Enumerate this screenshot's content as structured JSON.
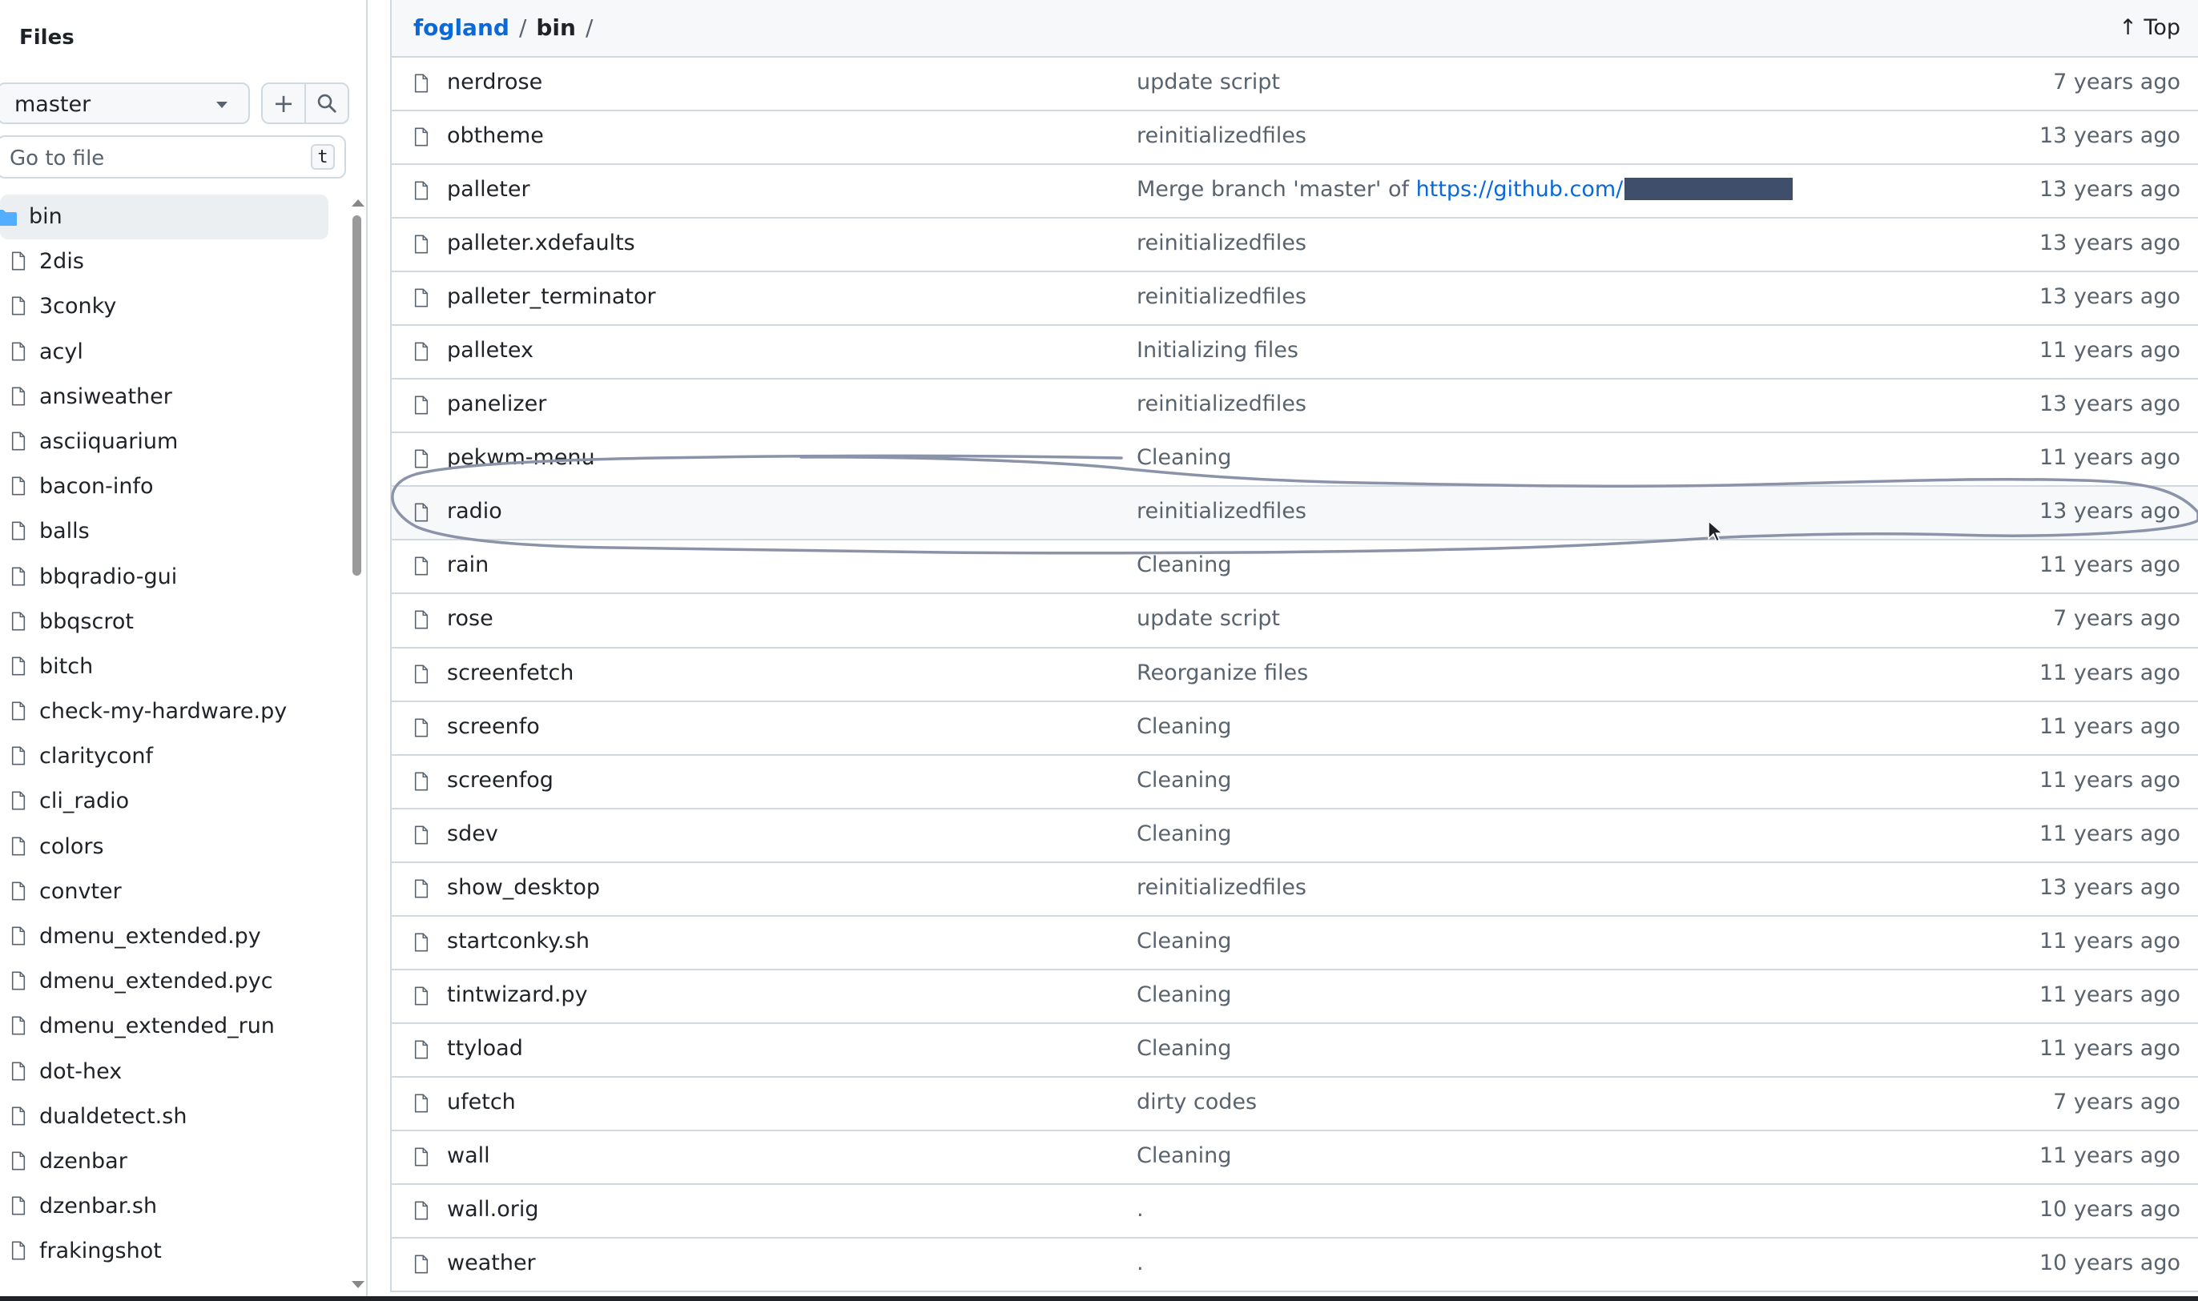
{
  "sidebar": {
    "title": "Files",
    "branch": "master",
    "add_icon": "plus-icon",
    "search_icon": "search-icon",
    "goto_placeholder": "Go to file",
    "goto_shortcut": "t",
    "tree": [
      {
        "label": "bin",
        "type": "folder",
        "selected": true
      },
      {
        "label": "2dis",
        "type": "file"
      },
      {
        "label": "3conky",
        "type": "file"
      },
      {
        "label": "acyl",
        "type": "file"
      },
      {
        "label": "ansiweather",
        "type": "file"
      },
      {
        "label": "asciiquarium",
        "type": "file"
      },
      {
        "label": "bacon-info",
        "type": "file"
      },
      {
        "label": "balls",
        "type": "file"
      },
      {
        "label": "bbqradio-gui",
        "type": "file"
      },
      {
        "label": "bbqscrot",
        "type": "file"
      },
      {
        "label": "bitch",
        "type": "file"
      },
      {
        "label": "check-my-hardware.py",
        "type": "file"
      },
      {
        "label": "clarityconf",
        "type": "file"
      },
      {
        "label": "cli_radio",
        "type": "file"
      },
      {
        "label": "colors",
        "type": "file"
      },
      {
        "label": "convter",
        "type": "file"
      },
      {
        "label": "dmenu_extended.py",
        "type": "file"
      },
      {
        "label": "dmenu_extended.pyc",
        "type": "file"
      },
      {
        "label": "dmenu_extended_run",
        "type": "file"
      },
      {
        "label": "dot-hex",
        "type": "file"
      },
      {
        "label": "dualdetect.sh",
        "type": "file"
      },
      {
        "label": "dzenbar",
        "type": "file"
      },
      {
        "label": "dzenbar.sh",
        "type": "file"
      },
      {
        "label": "frakingshot",
        "type": "file"
      }
    ]
  },
  "breadcrumb": {
    "repo": "fogland",
    "sep": "/",
    "dir": "bin",
    "trailing": "/"
  },
  "top_button": "↑ Top",
  "files": [
    {
      "name": "nerdrose",
      "message": "update script",
      "date": "7 years ago"
    },
    {
      "name": "obtheme",
      "message": "reinitializedfiles",
      "date": "13 years ago"
    },
    {
      "name": "palleter",
      "message": "Merge branch 'master' of ",
      "link": "https://github.com/",
      "redacted": true,
      "date": "13 years ago"
    },
    {
      "name": "palleter.xdefaults",
      "message": "reinitializedfiles",
      "date": "13 years ago"
    },
    {
      "name": "palleter_terminator",
      "message": "reinitializedfiles",
      "date": "13 years ago"
    },
    {
      "name": "palletex",
      "message": "Initializing files",
      "date": "11 years ago"
    },
    {
      "name": "panelizer",
      "message": "reinitializedfiles",
      "date": "13 years ago"
    },
    {
      "name": "pekwm-menu",
      "message": "Cleaning",
      "date": "11 years ago"
    },
    {
      "name": "radio",
      "message": "reinitializedfiles",
      "date": "13 years ago",
      "hover": true
    },
    {
      "name": "rain",
      "message": "Cleaning",
      "date": "11 years ago"
    },
    {
      "name": "rose",
      "message": "update script",
      "date": "7 years ago"
    },
    {
      "name": "screenfetch",
      "message": "Reorganize files",
      "date": "11 years ago"
    },
    {
      "name": "screenfo",
      "message": "Cleaning",
      "date": "11 years ago"
    },
    {
      "name": "screenfog",
      "message": "Cleaning",
      "date": "11 years ago"
    },
    {
      "name": "sdev",
      "message": "Cleaning",
      "date": "11 years ago"
    },
    {
      "name": "show_desktop",
      "message": "reinitializedfiles",
      "date": "13 years ago"
    },
    {
      "name": "startconky.sh",
      "message": "Cleaning",
      "date": "11 years ago"
    },
    {
      "name": "tintwizard.py",
      "message": "Cleaning",
      "date": "11 years ago"
    },
    {
      "name": "ttyload",
      "message": "Cleaning",
      "date": "11 years ago"
    },
    {
      "name": "ufetch",
      "message": "dirty codes",
      "date": "7 years ago"
    },
    {
      "name": "wall",
      "message": "Cleaning",
      "date": "11 years ago"
    },
    {
      "name": "wall.orig",
      "message": ".",
      "date": "10 years ago"
    },
    {
      "name": "weather",
      "message": ".",
      "date": "10 years ago"
    }
  ],
  "colors": {
    "link": "#0969da",
    "muted": "#59636e",
    "border": "#d1d9e0",
    "annotation": "#8b93a8",
    "redaction": "#3f4e6b"
  }
}
